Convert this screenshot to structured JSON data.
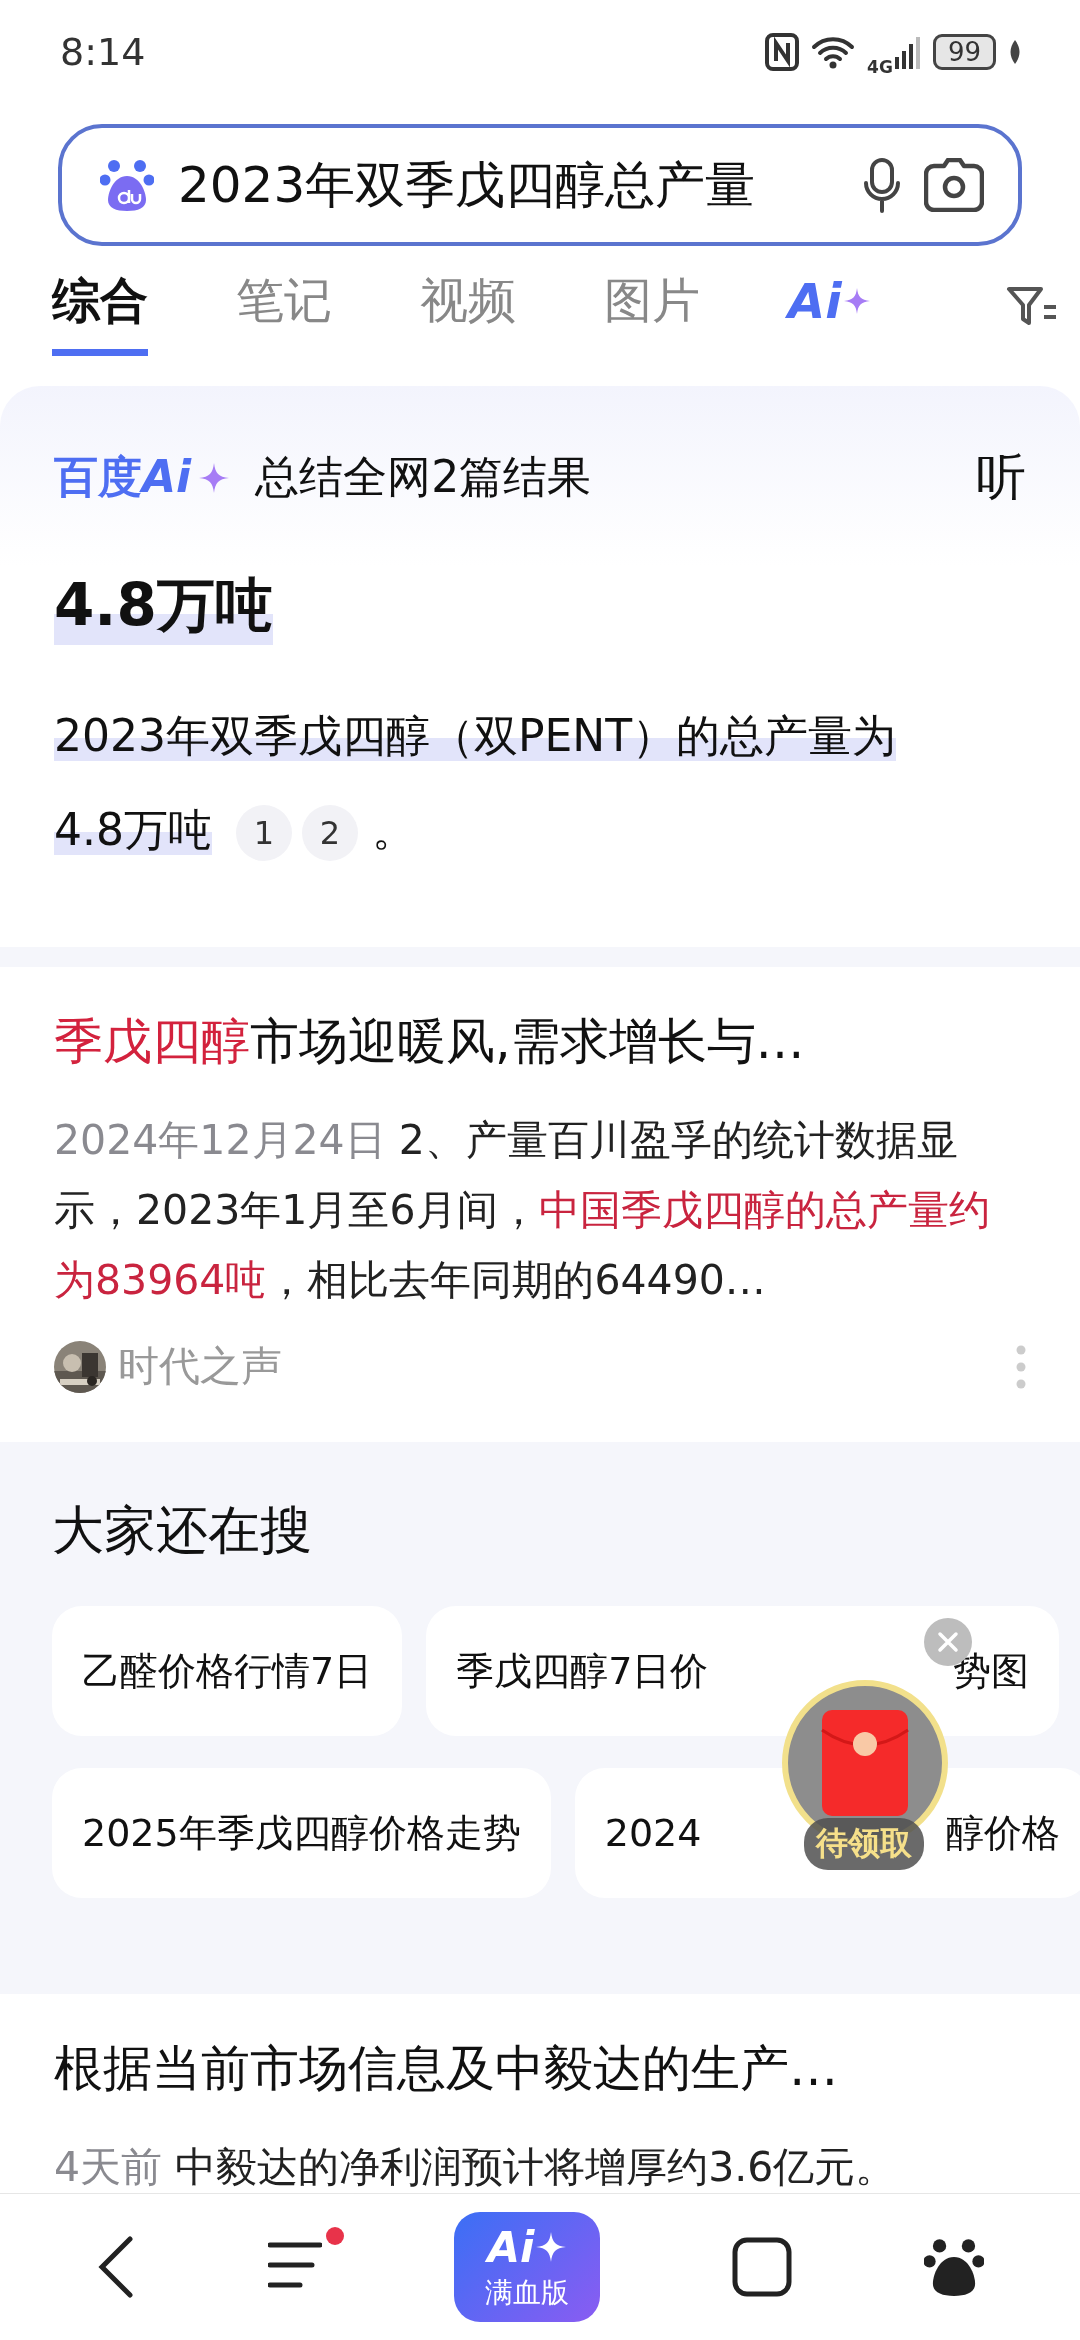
{
  "status_bar": {
    "time": "8:14",
    "network": "4G",
    "battery": "99"
  },
  "search": {
    "value": "2023年双季戊四醇总产量"
  },
  "tabs": [
    {
      "kind": "text",
      "label": "综合",
      "selected": true
    },
    {
      "kind": "text",
      "label": "笔记",
      "selected": false
    },
    {
      "kind": "text",
      "label": "视频",
      "selected": false
    },
    {
      "kind": "text",
      "label": "图片",
      "selected": false
    },
    {
      "kind": "ai",
      "label": "Ai",
      "selected": false
    }
  ],
  "ai_summary": {
    "brand": "百度",
    "brand_ai": "Ai",
    "title": "总结全网2篇结果",
    "listen": "听",
    "headline": "4.8万吨",
    "answer": "2023年双季戊四醇（双PENT）的总产量为4.8万吨",
    "citations": [
      "1",
      "2"
    ],
    "end": "。"
  },
  "result": {
    "title": [
      {
        "text": "季戊四醇",
        "highlight": true
      },
      {
        "text": "市场迎暖风,需求增长与…",
        "highlight": false
      }
    ],
    "date": "2024年12月24日",
    "snippet": [
      {
        "text": " 2、产量百川盈孚的统计数据显示，2023年1月至6月间，",
        "highlight": false
      },
      {
        "text": "中国季戊四醇的总产量约为83964吨",
        "highlight": true
      },
      {
        "text": "，相比去年同期的64490…",
        "highlight": false
      }
    ],
    "source": "时代之声"
  },
  "related": {
    "title": "大家还在搜",
    "chips": [
      [
        [
          "乙醛价格行情7日"
        ],
        [
          "季戊四醇7日价",
          "势图"
        ]
      ],
      [
        [
          "2025年季戊四醇价格走势"
        ],
        [
          "2024",
          "醇价格"
        ]
      ]
    ]
  },
  "result_2": {
    "title": "根据当前市场信息及中毅达的生产…",
    "date": "4天前",
    "snippet": " 中毅达的净利润预计将增厚约3.6亿元。"
  },
  "floating_reward": {
    "label": "待领取"
  },
  "nav": {
    "menu_notification": true,
    "ai_button": {
      "logo": "Ai",
      "label": "满血版"
    }
  }
}
